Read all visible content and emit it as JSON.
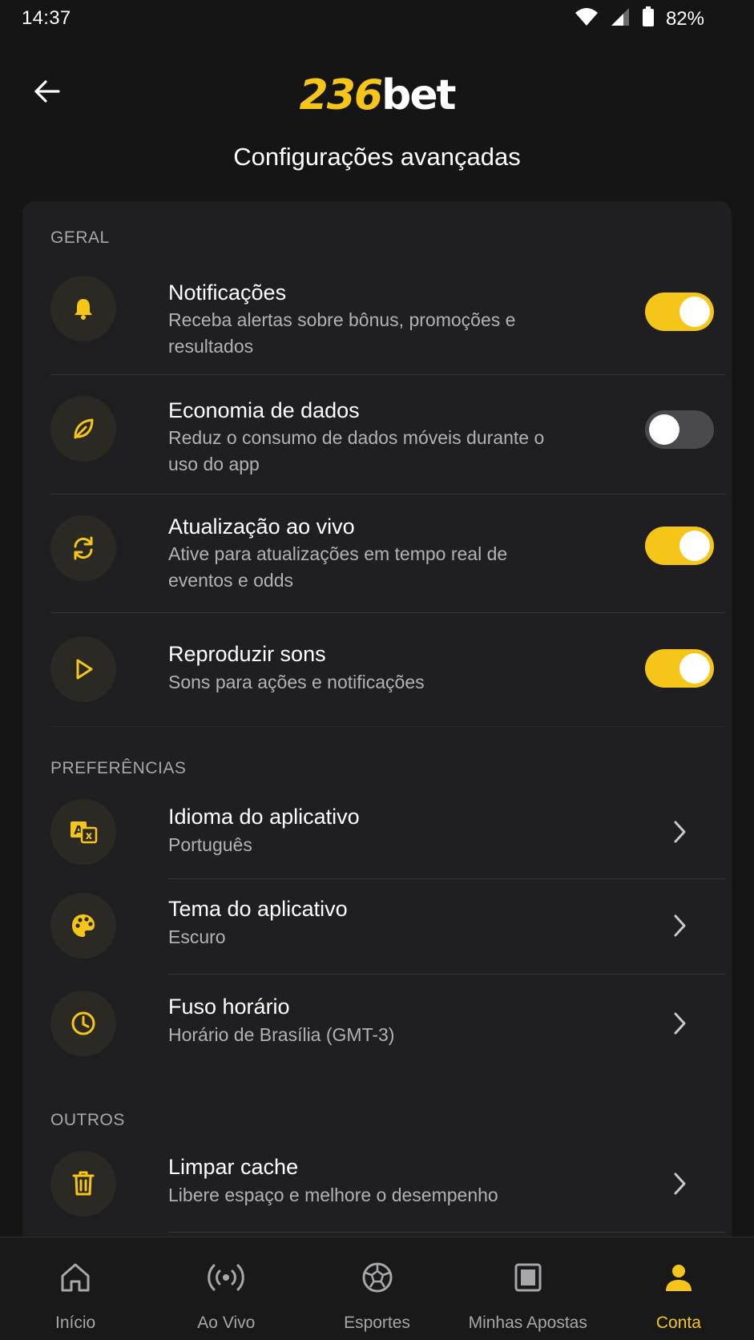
{
  "status_bar": {
    "time": "14:37",
    "battery": "82%"
  },
  "header": {
    "logo_number": "236",
    "logo_word": "bet",
    "title": "Configurações avançadas"
  },
  "sections": {
    "geral": {
      "label": "GERAL",
      "items": [
        {
          "title": "Notificações",
          "subtitle": "Receba alertas sobre bônus, promoções e resultados",
          "icon": "bell-icon",
          "toggle_on": true
        },
        {
          "title": "Economia de dados",
          "subtitle": "Reduz o consumo de dados móveis durante o uso do app",
          "icon": "leaf-icon",
          "toggle_on": false
        },
        {
          "title": "Atualização ao vivo",
          "subtitle": "Ative para atualizações em tempo real de eventos e odds",
          "icon": "refresh-icon",
          "toggle_on": true
        },
        {
          "title": "Reproduzir sons",
          "subtitle": "Sons para ações e notificações",
          "icon": "play-icon",
          "toggle_on": true
        }
      ]
    },
    "preferencias": {
      "label": "PREFERÊNCIAS",
      "items": [
        {
          "title": "Idioma do aplicativo",
          "subtitle": "Português",
          "icon": "translate-icon"
        },
        {
          "title": "Tema do aplicativo",
          "subtitle": "Escuro",
          "icon": "palette-icon"
        },
        {
          "title": "Fuso horário",
          "subtitle": "Horário de Brasília (GMT-3)",
          "icon": "clock-icon"
        }
      ]
    },
    "outros": {
      "label": "OUTROS",
      "items": [
        {
          "title": "Limpar cache",
          "subtitle": "Libere espaço e melhore o desempenho",
          "icon": "trash-icon"
        }
      ]
    }
  },
  "bottom_nav": [
    {
      "label": "Início",
      "icon": "home-icon",
      "active": false
    },
    {
      "label": "Ao Vivo",
      "icon": "live-icon",
      "active": false
    },
    {
      "label": "Esportes",
      "icon": "soccer-ball-icon",
      "active": false
    },
    {
      "label": "Minhas Apostas",
      "icon": "ticket-icon",
      "active": false
    },
    {
      "label": "Conta",
      "icon": "user-icon",
      "active": true
    }
  ],
  "colors": {
    "accent": "#f5c518",
    "background": "#151516",
    "card": "#1f1f21"
  }
}
